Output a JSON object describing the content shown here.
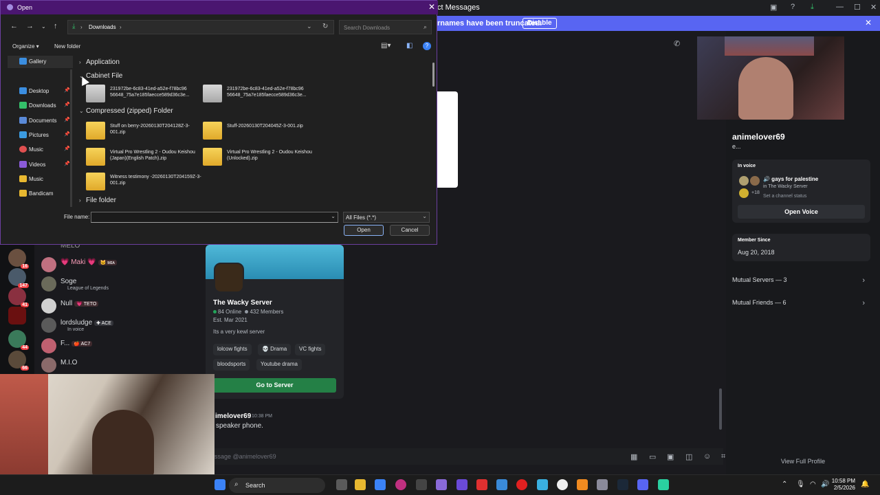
{
  "discord": {
    "title": "ct Messages",
    "notice": {
      "text": "rnames have been truncated.",
      "button": "Disable"
    },
    "members": [
      {
        "name": "MELO",
        "sub": "",
        "tag": ""
      },
      {
        "name": "💗 Maki 💗",
        "sub": "",
        "tag": "🐱 ᴍɪᴀ"
      },
      {
        "name": "Soge",
        "sub": "League of Legends",
        "tag": ""
      },
      {
        "name": "Null",
        "sub": "",
        "tag": "💗 TETO"
      },
      {
        "name": "lordsludge",
        "sub": "In voice",
        "tag": "✚ ACE"
      },
      {
        "name": "F...",
        "sub": "",
        "tag": "🍎 AC7"
      },
      {
        "name": "M.I.O",
        "sub": "",
        "tag": ""
      }
    ],
    "rail_badges": [
      "16",
      "147",
      "41",
      "44",
      "66"
    ],
    "server_card": {
      "name": "The Wacky Server",
      "online": "84 Online",
      "members": "432 Members",
      "established": "Est. Mar 2021",
      "description": "Its a very kewl server",
      "chips": [
        "lolcow fights",
        "💀 Drama",
        "VC fights",
        "bloodsports",
        "Youtube drama"
      ],
      "go_button": "Go to Server"
    },
    "chat": {
      "author": "imelover69",
      "time": "10:38 PM",
      "message": "speaker phone.",
      "placeholder": "ssage @animelover69"
    },
    "profile": {
      "username": "animelover69",
      "status": "e...",
      "in_voice_label": "In voice",
      "voice_channel": "🔊 gays for palestine",
      "voice_server": "in The Wacky Server",
      "voice_count": "+18",
      "channel_status": "Set a channel status",
      "open_voice": "Open Voice",
      "member_since_label": "Member Since",
      "member_since": "Aug 20, 2018",
      "mutual_servers": "Mutual Servers — 3",
      "mutual_friends": "Mutual Friends — 6",
      "view_full": "View Full Profile"
    }
  },
  "dialog": {
    "title": "Open",
    "breadcrumb": "Downloads",
    "search_placeholder": "Search Downloads",
    "commands": {
      "organize": "Organize ▾",
      "new_folder": "New folder"
    },
    "nav": [
      {
        "label": "Gallery",
        "color": "#3b8ee0",
        "pinned": false
      },
      {
        "label": "Desktop",
        "color": "#3b8ee0",
        "pinned": true
      },
      {
        "label": "Downloads",
        "color": "#34c06a",
        "pinned": true
      },
      {
        "label": "Documents",
        "color": "#5a8ad8",
        "pinned": true
      },
      {
        "label": "Pictures",
        "color": "#3b9be0",
        "pinned": true
      },
      {
        "label": "Music",
        "color": "#e05050",
        "pinned": true
      },
      {
        "label": "Videos",
        "color": "#8a5ad8",
        "pinned": true
      },
      {
        "label": "Music",
        "color": "#e8b830",
        "pinned": false
      },
      {
        "label": "Bandicam",
        "color": "#e8b830",
        "pinned": false
      }
    ],
    "groups": {
      "application": "Application",
      "cabinet": "Cabinet File",
      "zipped": "Compressed (zipped) Folder",
      "file_folder": "File folder"
    },
    "cab_files": [
      "231972be-6c83-41ed-a52e-f78bc96 56648_75a7e185faecce589d36c3e...",
      "231972be-6c83-41ed-a52e-f78bc96 56648_75a7e185faecce589d36c3e..."
    ],
    "zip_files": [
      "Stuff on berry-20260130T204128Z-3-001.zip",
      "Stuff-20260130T204045Z-3-001.zip",
      "Virtual Pro Wrestling 2 - Oudou Keishou (Japan)(English Patch).zip",
      "Virtual Pro Wrestling 2 - Oudou Keishou (Unlocked).zip",
      "Witness testimony -20260130T204159Z-3-001.zip"
    ],
    "file_name_label": "File name:",
    "file_name_value": "",
    "file_type": "All Files (*.*)",
    "open_button": "Open",
    "cancel_button": "Cancel"
  },
  "taskbar": {
    "search": "Search",
    "time": "10:58 PM",
    "date": "2/5/2026"
  }
}
